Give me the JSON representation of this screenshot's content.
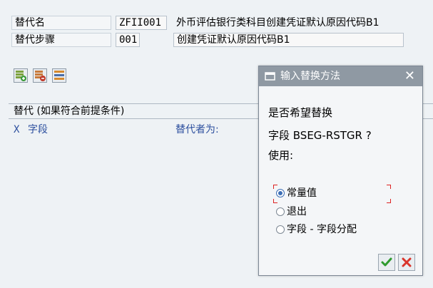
{
  "form": {
    "substitution_label": "替代名",
    "substitution_value": "ZFII001",
    "substitution_desc": "外币评估银行类科目创建凭证默认原因代码B1",
    "step_label": "替代步骤",
    "step_value": "001",
    "step_desc": "创建凭证默认原因代码B1"
  },
  "toolbar": {
    "icons": [
      "insert-row-icon",
      "delete-row-icon",
      "list-icon"
    ]
  },
  "section": {
    "title": "替代 (如果符合前提条件)",
    "col_x": "X",
    "col_field": "字段",
    "col_replace": "替代者为:"
  },
  "dialog": {
    "title": "输入替换方法",
    "line1": "是否希望替换",
    "line2": "字段 BSEG-RSTGR ?",
    "line3": "使用:",
    "options": [
      {
        "label": "常量值",
        "selected": true
      },
      {
        "label": "退出",
        "selected": false
      },
      {
        "label": "字段 - 字段分配",
        "selected": false
      }
    ],
    "ok_icon": "checkmark-icon",
    "cancel_icon": "cancel-x-icon",
    "close_icon": "close-icon",
    "title_icon": "window-icon"
  },
  "colors": {
    "accent_blue": "#2c4f9e",
    "ok_green": "#2e9a2e",
    "cancel_red": "#d9342b",
    "dialog_header": "#8f99a3"
  }
}
